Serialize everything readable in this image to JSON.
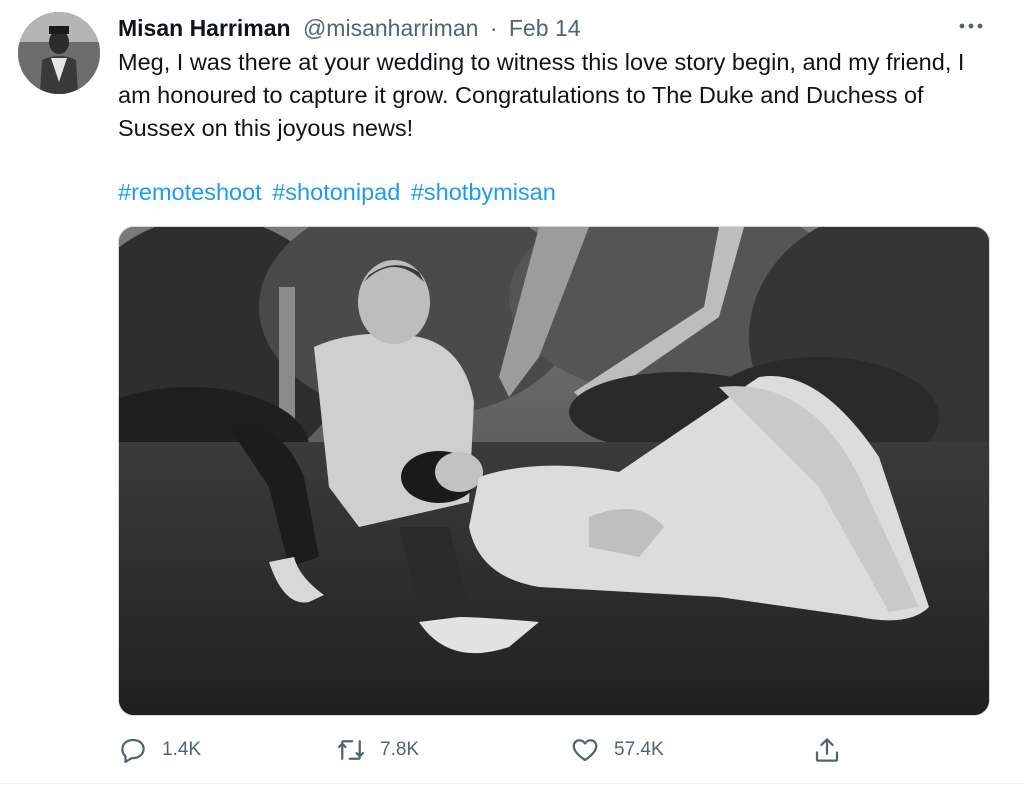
{
  "author": {
    "name": "Misan Harriman",
    "handle": "@misanharriman",
    "separator": "·",
    "date": "Feb 14"
  },
  "tweet": {
    "text": "Meg, I was there at your wedding to witness this love story begin, and my friend, I am honoured to capture it grow. Congratulations to The Duke and Duchess of Sussex on this joyous news!",
    "hashtags": [
      "#remoteshoot",
      "#shotonipad",
      "#shotbymisan"
    ]
  },
  "actions": {
    "reply_count": "1.4K",
    "retweet_count": "7.8K",
    "like_count": "57.4K"
  },
  "icons": {
    "more": "more-options-icon",
    "reply": "reply-icon",
    "retweet": "retweet-icon",
    "like": "heart-icon",
    "share": "share-icon"
  },
  "colors": {
    "link": "#1d9bf0",
    "secondary_text": "#536471",
    "primary_text": "#0f1419"
  }
}
